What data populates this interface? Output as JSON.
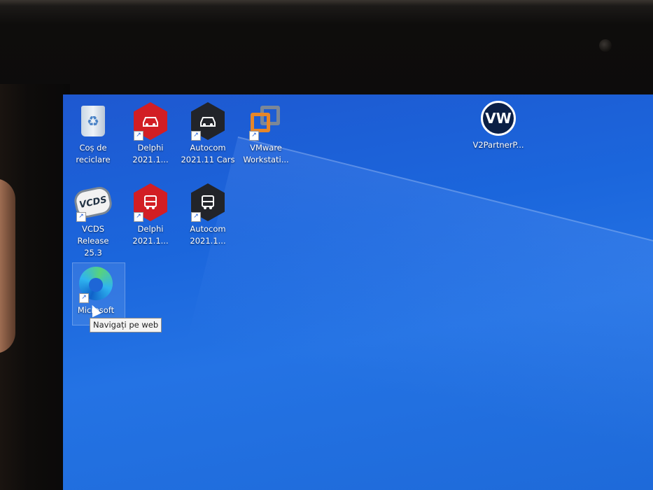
{
  "desktop": {
    "icons": [
      {
        "id": "recycle-bin",
        "label": "Coș de\nreciclare",
        "icon": "recycle-bin-icon",
        "shortcut": false
      },
      {
        "id": "delphi-cars",
        "label": "Delphi\n2021.1...",
        "icon": "car-icon",
        "shortcut": true
      },
      {
        "id": "autocom-cars",
        "label": "Autocom\n2021.11 Cars",
        "icon": "car-icon",
        "shortcut": true
      },
      {
        "id": "vmware",
        "label": "VMware\nWorkstati...",
        "icon": "vmware-icon",
        "shortcut": true
      },
      {
        "id": "vcds",
        "label": "VCDS Release\n25.3",
        "icon": "vcds-icon",
        "shortcut": true
      },
      {
        "id": "delphi-trucks",
        "label": "Delphi\n2021.1...",
        "icon": "truck-icon",
        "shortcut": true
      },
      {
        "id": "autocom-trucks",
        "label": "Autocom\n2021.1...",
        "icon": "truck-icon",
        "shortcut": true
      },
      {
        "id": "edge",
        "label": "Microsoft",
        "icon": "edge-icon",
        "shortcut": true
      },
      {
        "id": "v2partner",
        "label": "V2PartnerP...",
        "icon": "vw-logo-icon",
        "shortcut": false
      }
    ],
    "tooltip": "Navigați pe web",
    "vcds_badge": "VCDS",
    "vw_badge": "VW"
  },
  "colors": {
    "wallpaper": "#1b66dc",
    "delphi_red": "#d21e24",
    "autocom_dark": "#222429"
  }
}
